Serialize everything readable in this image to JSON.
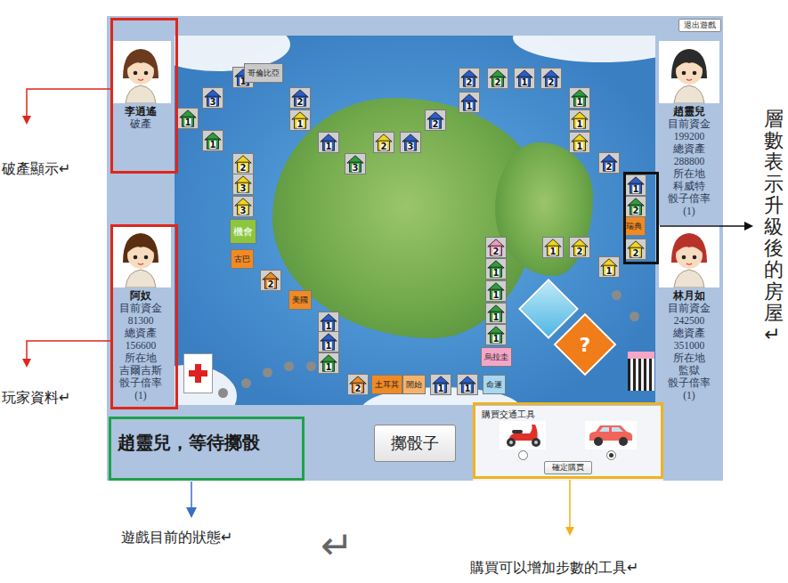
{
  "exit_button": "退出遊戲",
  "players": [
    {
      "name": "李逍遙",
      "lines": [
        "破產"
      ],
      "color": "#6b3a1f"
    },
    {
      "name": "阿奴",
      "lines": [
        "目前資金",
        "81300",
        "總資產",
        "156600",
        "所在地",
        "吉爾吉斯",
        "骰子倍率",
        "(1)"
      ],
      "color": "#5a2e10"
    },
    {
      "name": "趙靈兒",
      "lines": [
        "目前資金",
        "199200",
        "總資產",
        "288800",
        "所在地",
        "科威特",
        "骰子倍率",
        "(1)"
      ],
      "color": "#2b2b2b"
    },
    {
      "name": "林月如",
      "lines": [
        "目前資金",
        "242500",
        "總資產",
        "351000",
        "所在地",
        "監獄",
        "骰子倍率",
        "(1)"
      ],
      "color": "#b8322a"
    }
  ],
  "board": {
    "chance_mark": "?",
    "tiles": [
      {
        "kind": "house",
        "level": "1",
        "color": "#2c5ec9"
      },
      {
        "kind": "place",
        "label": "哥倫比亞",
        "color": "#c9c9c9"
      },
      {
        "kind": "house",
        "level": "3",
        "color": "#2c5ec9"
      },
      {
        "kind": "house",
        "level": "1",
        "color": "#2e9e3a"
      },
      {
        "kind": "house",
        "level": "1",
        "color": "#2e9e3a"
      },
      {
        "kind": "house",
        "level": "2",
        "color": "#f2d51c"
      },
      {
        "kind": "house",
        "level": "3",
        "color": "#f2d51c"
      },
      {
        "kind": "house",
        "level": "3",
        "color": "#f2d51c"
      },
      {
        "kind": "place",
        "label": "機會",
        "color": "#8cc63f"
      },
      {
        "kind": "place",
        "label": "古巴",
        "color": "#f08a24"
      },
      {
        "kind": "house",
        "level": "2",
        "color": "#f08a24"
      },
      {
        "kind": "place",
        "label": "美國",
        "color": "#f08a24"
      },
      {
        "kind": "house",
        "level": "1",
        "color": "#2c5ec9"
      },
      {
        "kind": "house",
        "level": "1",
        "color": "#2c5ec9"
      },
      {
        "kind": "house",
        "level": "1",
        "color": "#2e9e3a"
      },
      {
        "kind": "house",
        "level": "2",
        "color": "#f08a24"
      },
      {
        "kind": "place",
        "label": "土耳其",
        "color": "#f08a24"
      },
      {
        "kind": "place",
        "label": "開始",
        "color": "#f6b26b"
      },
      {
        "kind": "house",
        "level": "1",
        "color": "#2c5ec9"
      },
      {
        "kind": "house",
        "level": "1",
        "color": "#2c5ec9"
      },
      {
        "kind": "place",
        "label": "命運",
        "color": "#a6d8f0"
      },
      {
        "kind": "place",
        "label": "烏拉圭",
        "color": "#f4a6c8"
      },
      {
        "kind": "house",
        "level": "1",
        "color": "#2e9e3a"
      },
      {
        "kind": "house",
        "level": "1",
        "color": "#2e9e3a"
      },
      {
        "kind": "house",
        "level": "1",
        "color": "#2e9e3a"
      },
      {
        "kind": "house",
        "level": "1",
        "color": "#2e9e3a"
      },
      {
        "kind": "house",
        "level": "2",
        "color": "#f49ac1"
      },
      {
        "kind": "house",
        "level": "1",
        "color": "#f2d51c"
      },
      {
        "kind": "house",
        "level": "2",
        "color": "#f2d51c"
      },
      {
        "kind": "house",
        "level": "1",
        "color": "#f2d51c"
      },
      {
        "kind": "house",
        "level": "2",
        "color": "#f2d51c"
      },
      {
        "kind": "place",
        "label": "瑞典",
        "color": "#f08a24"
      },
      {
        "kind": "house",
        "level": "2",
        "color": "#2e9e3a"
      },
      {
        "kind": "house",
        "level": "1",
        "color": "#2c5ec9"
      },
      {
        "kind": "house",
        "level": "2",
        "color": "#2c5ec9"
      },
      {
        "kind": "house",
        "level": "1",
        "color": "#f2d51c"
      },
      {
        "kind": "house",
        "level": "1",
        "color": "#f2d51c"
      },
      {
        "kind": "house",
        "level": "1",
        "color": "#2e9e3a"
      },
      {
        "kind": "house",
        "level": "2",
        "color": "#2c5ec9"
      },
      {
        "kind": "house",
        "level": "1",
        "color": "#2c5ec9"
      },
      {
        "kind": "house",
        "level": "2",
        "color": "#2e9e3a"
      },
      {
        "kind": "house",
        "level": "2",
        "color": "#2c5ec9"
      },
      {
        "kind": "house",
        "level": "1",
        "color": "#2c5ec9"
      },
      {
        "kind": "house",
        "level": "2",
        "color": "#2c5ec9"
      },
      {
        "kind": "house",
        "level": "3",
        "color": "#2c5ec9"
      },
      {
        "kind": "house",
        "level": "2",
        "color": "#f2d51c"
      },
      {
        "kind": "house",
        "level": "3",
        "color": "#2e9e3a"
      },
      {
        "kind": "house",
        "level": "1",
        "color": "#2c5ec9"
      },
      {
        "kind": "house",
        "level": "1",
        "color": "#f2d51c"
      },
      {
        "kind": "house",
        "level": "2",
        "color": "#2c5ec9"
      }
    ]
  },
  "status": "趙靈兒，等待擲骰",
  "roll_button": "擲骰子",
  "transport": {
    "title": "購買交通工具",
    "options": [
      {
        "kind": "scooter",
        "selected": false
      },
      {
        "kind": "car",
        "selected": true
      }
    ],
    "button": "確定購買"
  },
  "annotations": [
    {
      "text": "破產顯示↵",
      "box_color": "#e0261c",
      "arrow_color": "#e0261c"
    },
    {
      "text": "玩家資料↵",
      "box_color": "#e0261c",
      "arrow_color": "#e0261c"
    },
    {
      "text": "遊戲目前的狀態↵",
      "box_color": "#1ea24a",
      "arrow_color": "#3a6fc4"
    },
    {
      "text": "購買可以增加步數的工具↵",
      "box_color": "#f2b21c",
      "arrow_color": "#f2b21c"
    },
    {
      "text": "層數表示升級後的房屋↵",
      "box_color": "#111111",
      "arrow_color": "#111111"
    }
  ],
  "page_mark": "↵"
}
